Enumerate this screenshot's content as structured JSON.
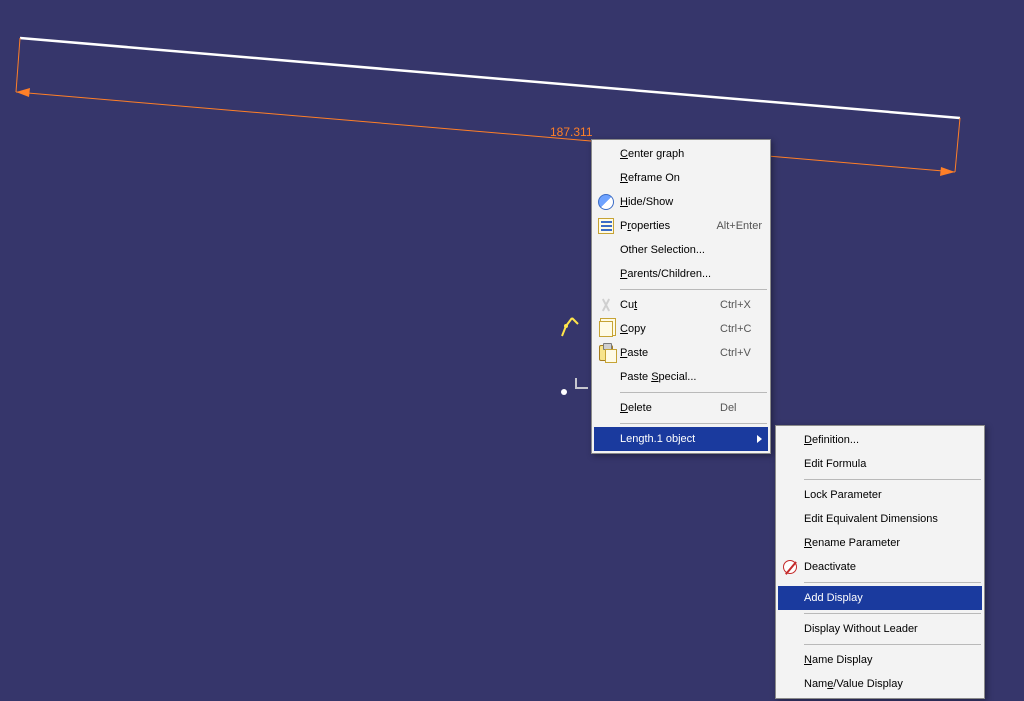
{
  "dim_label": "187.311",
  "menu": {
    "center_graph": "Center graph",
    "reframe_on": "Reframe On",
    "hide_show": "Hide/Show",
    "properties": "Properties",
    "properties_shortcut": "Alt+Enter",
    "other_selection": "Other Selection...",
    "parents_children": "Parents/Children...",
    "cut": "Cut",
    "cut_shortcut": "Ctrl+X",
    "copy": "Copy",
    "copy_shortcut": "Ctrl+C",
    "paste": "Paste",
    "paste_shortcut": "Ctrl+V",
    "paste_special": "Paste Special...",
    "delete": "Delete",
    "delete_shortcut": "Del",
    "length_object": "Length.1 object"
  },
  "submenu": {
    "definition": "Definition...",
    "edit_formula": "Edit Formula",
    "lock_parameter": "Lock Parameter",
    "edit_equiv_dims": "Edit Equivalent Dimensions",
    "rename_parameter": "Rename Parameter",
    "deactivate": "Deactivate",
    "add_display": "Add Display",
    "display_without_leader": "Display Without Leader",
    "name_display": "Name Display",
    "name_value_display": "Name/Value Display"
  }
}
